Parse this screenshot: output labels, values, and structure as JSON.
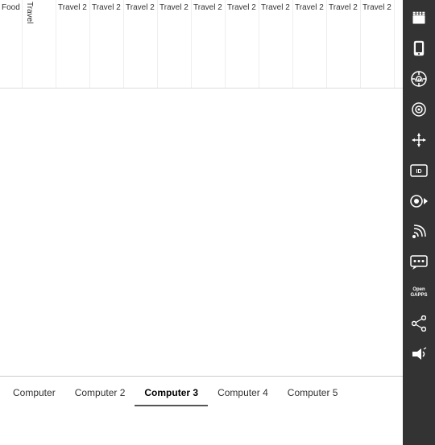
{
  "sidebar": {
    "icons": [
      {
        "name": "clapper-icon",
        "symbol": "🎬",
        "label": "Clapper"
      },
      {
        "name": "phone-icon",
        "symbol": "📱",
        "label": "Phone"
      },
      {
        "name": "gps-icon",
        "symbol": "GPS",
        "label": "GPS",
        "isText": true
      },
      {
        "name": "webcam-icon",
        "symbol": "⊙",
        "label": "Webcam"
      },
      {
        "name": "move-icon",
        "symbol": "✛",
        "label": "Move"
      },
      {
        "name": "id-icon",
        "symbol": "ID",
        "label": "ID",
        "isText": true
      },
      {
        "name": "record-icon",
        "symbol": "⏺",
        "label": "Record"
      },
      {
        "name": "rss-icon",
        "symbol": "📡",
        "label": "RSS"
      },
      {
        "name": "chat-icon",
        "symbol": "...",
        "label": "Chat",
        "isText": true
      },
      {
        "name": "open-gapps-icon",
        "symbol": "OpenGAPPS",
        "label": "OpenGAPPS",
        "isText": true
      },
      {
        "name": "share-icon",
        "symbol": "🔗",
        "label": "Share"
      },
      {
        "name": "volume-icon",
        "symbol": "🔊",
        "label": "Volume"
      }
    ]
  },
  "header": {
    "columns": [
      {
        "id": "col-food",
        "label": "Food"
      },
      {
        "id": "col-travel-abbr",
        "label": "T r a v el"
      },
      {
        "id": "col-travel-2a",
        "label": "Travel 2"
      },
      {
        "id": "col-travel-2b",
        "label": "Travel 2"
      },
      {
        "id": "col-travel-2c",
        "label": "Travel 2"
      },
      {
        "id": "col-travel-2d",
        "label": "Travel 2"
      },
      {
        "id": "col-travel-2e",
        "label": "Travel 2"
      },
      {
        "id": "col-travel-2f",
        "label": "Travel 2"
      },
      {
        "id": "col-travel-2g",
        "label": "Travel 2"
      },
      {
        "id": "col-travel-2h",
        "label": "Travel 2"
      },
      {
        "id": "col-travel-2i",
        "label": "Travel 2"
      },
      {
        "id": "col-travel-2j",
        "label": "Travel 2"
      }
    ]
  },
  "tabs": [
    {
      "id": "tab-computer",
      "label": "Computer",
      "active": false
    },
    {
      "id": "tab-computer2",
      "label": "Computer 2",
      "active": false
    },
    {
      "id": "tab-computer3",
      "label": "Computer 3",
      "active": true
    },
    {
      "id": "tab-computer4",
      "label": "Computer 4",
      "active": false
    },
    {
      "id": "tab-computer5",
      "label": "Computer 5",
      "active": false
    }
  ]
}
